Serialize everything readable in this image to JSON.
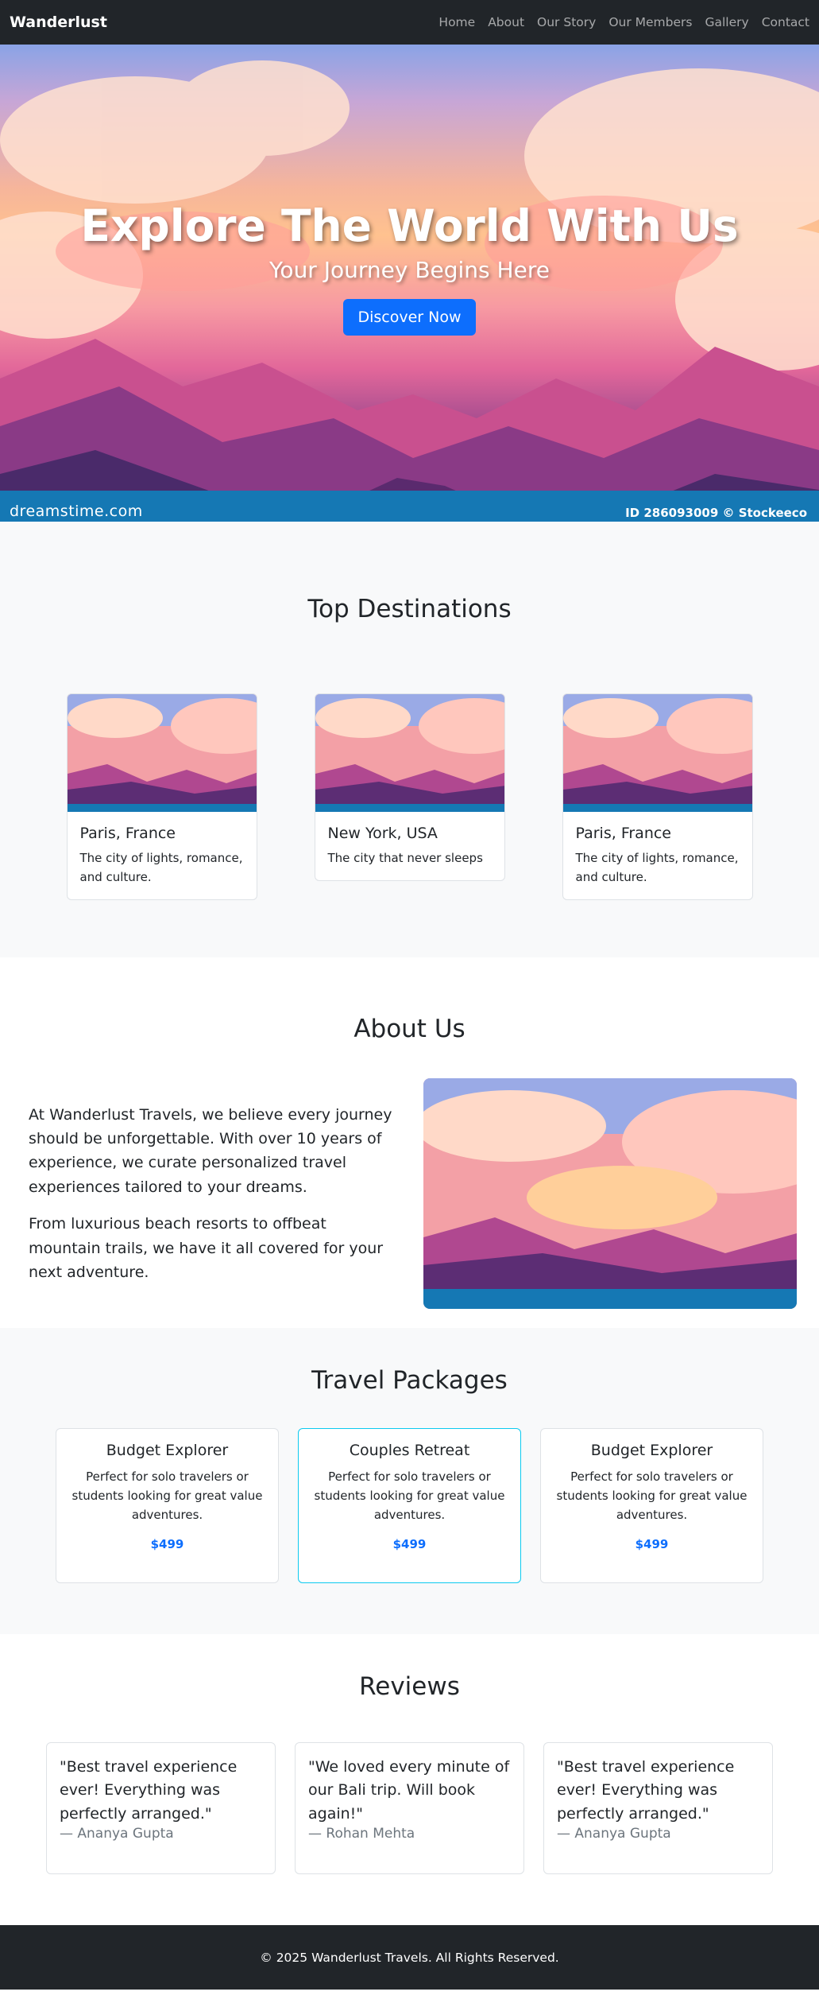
{
  "nav": {
    "brand": "Wanderlust",
    "links": [
      "Home",
      "About",
      "Our Story",
      "Our Members",
      "Gallery",
      "Contact"
    ]
  },
  "hero": {
    "title": "Explore The World With Us",
    "subtitle": "Your Journey Begins Here",
    "cta": "Discover Now",
    "watermark_logo": "dreamstime.com",
    "watermark_id": "ID 286093009 © Stockeeco"
  },
  "destinations": {
    "heading": "Top Destinations",
    "items": [
      {
        "title": "Paris, France",
        "text": "The city of lights, romance, and culture."
      },
      {
        "title": "New York, USA",
        "text": "The city that never sleeps"
      },
      {
        "title": "Paris, France",
        "text": "The city of lights, romance, and culture."
      }
    ]
  },
  "about": {
    "heading": "About Us",
    "p1": "At Wanderlust Travels, we believe every journey should be unforgettable. With over 10 years of experience, we curate personalized travel experiences tailored to your dreams.",
    "p2": "From luxurious beach resorts to offbeat mountain trails, we have it all covered for your next adventure."
  },
  "packages": {
    "heading": "Travel Packages",
    "items": [
      {
        "title": "Budget Explorer",
        "text": "Perfect for solo travelers or students looking for great value adventures.",
        "price": "$499"
      },
      {
        "title": "Couples Retreat",
        "text": "Perfect for solo travelers or students looking for great value adventures.",
        "price": "$499"
      },
      {
        "title": "Budget Explorer",
        "text": "Perfect for solo travelers or students looking for great value adventures.",
        "price": "$499"
      }
    ]
  },
  "reviews": {
    "heading": "Reviews",
    "items": [
      {
        "quote": "\"Best travel experience ever! Everything was perfectly arranged.\"",
        "author": "— Ananya Gupta"
      },
      {
        "quote": "\"We loved every minute of our Bali trip. Will book again!\"",
        "author": "— Rohan Mehta"
      },
      {
        "quote": "\"Best travel experience ever! Everything was perfectly arranged.\"",
        "author": "— Ananya Gupta"
      }
    ]
  },
  "footer": {
    "text": "© 2025 Wanderlust Travels. All Rights Reserved."
  },
  "colors": {
    "nav_bg": "#212529",
    "primary": "#0d6efd",
    "featured_border": "#0dcaf0",
    "watermark_strip": "#1578b4"
  }
}
